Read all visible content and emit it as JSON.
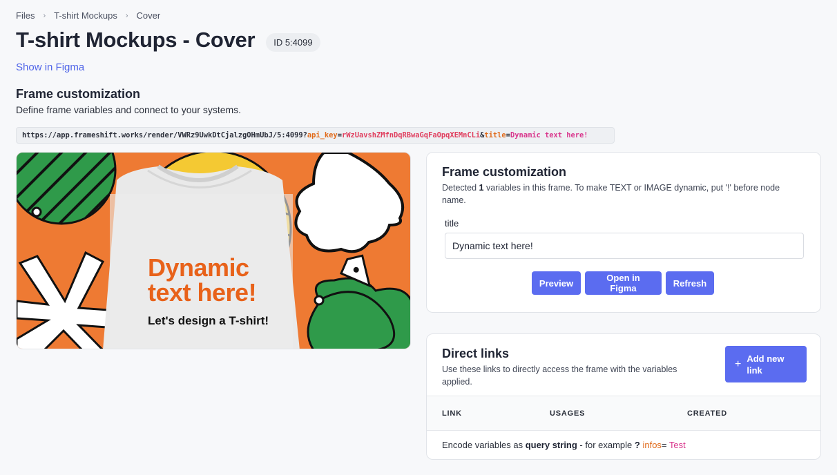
{
  "breadcrumb": [
    "Files",
    "T-shirt Mockups",
    "Cover"
  ],
  "page": {
    "title": "T-shirt Mockups - Cover",
    "id_badge": "ID 5:4099",
    "show_in_figma": "Show in Figma"
  },
  "section": {
    "title": "Frame customization",
    "subtitle": "Define frame variables and connect to your systems."
  },
  "url": {
    "base": "https://app.frameshift.works/render/VWRz9UwkDtCjalzgOHmUbJ/5:4099?",
    "key1": "api_key",
    "eq1": "=",
    "val1": "rWzUavshZMfnDqRBwaGqFaOpqXEMnCLi",
    "amp": "&",
    "key2": "title",
    "eq2": "=",
    "val2": "Dynamic text here!"
  },
  "preview": {
    "headline_line1": "Dynamic",
    "headline_line2": "text here!",
    "tagline": "Let's design a T-shirt!"
  },
  "customization": {
    "title": "Frame customization",
    "desc_prefix": "Detected ",
    "var_count": "1",
    "desc_suffix": " variables in this frame. To make TEXT or IMAGE dynamic, put '!' before node name.",
    "field_label": "title",
    "field_value": "Dynamic text here!",
    "buttons": {
      "preview": "Preview",
      "open": "Open in Figma",
      "refresh": "Refresh"
    }
  },
  "links": {
    "title": "Direct links",
    "desc": "Use these links to directly access the frame with the variables applied.",
    "add_button": "Add new link",
    "add_icon": "+",
    "columns": [
      "LINK",
      "USAGES",
      "CREATED"
    ],
    "note_prefix": "Encode variables as ",
    "note_bold": "query string",
    "note_mid": " - for example ",
    "note_q": "?",
    "note_key": " infos",
    "note_eq": "=",
    "note_val": " Test"
  },
  "colors": {
    "accent": "#5b6cf0",
    "link": "#4f64e8",
    "preview_bg": "#ee7a33",
    "headline": "#e8621a"
  }
}
